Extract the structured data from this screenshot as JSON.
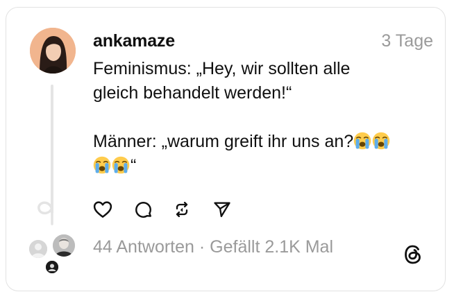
{
  "post": {
    "username": "ankamaze",
    "timestamp": "3 Tage",
    "lines": [
      "Feminismus: „Hey, wir sollten alle",
      "gleich behandelt werden!“",
      "Männer: „warum greift ihr uns an?",
      "“"
    ],
    "emoji": "loudly-crying-face",
    "emoji_count_line3": 2,
    "emoji_count_line4": 2
  },
  "actions": [
    {
      "name": "like-button",
      "icon": "heart-icon"
    },
    {
      "name": "reply-button",
      "icon": "comment-icon"
    },
    {
      "name": "repost-button",
      "icon": "repost-icon"
    },
    {
      "name": "share-button",
      "icon": "send-icon"
    }
  ],
  "stats": {
    "replies": "44 Antworten",
    "separator": " · ",
    "likes": "Gefällt 2.1K Mal"
  },
  "colors": {
    "text": "#101010",
    "muted": "#9a9a9a",
    "border": "#e2e2e2",
    "avatar_bg": "#f3b48a"
  },
  "brand_icon": "threads-logo-icon"
}
